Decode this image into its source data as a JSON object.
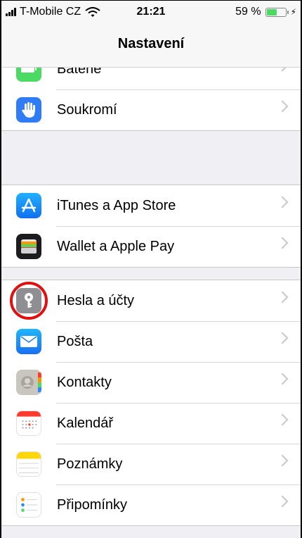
{
  "status_bar": {
    "carrier": "T-Mobile CZ",
    "time": "21:21",
    "battery_percent": "59 %",
    "battery_level": 0.59
  },
  "nav": {
    "title": "Nastavení"
  },
  "groups": [
    {
      "items": [
        {
          "label": "Baterie",
          "icon": "battery-icon",
          "color": "#4cd964"
        },
        {
          "label": "Soukromí",
          "icon": "hand-icon",
          "color": "#2f7cf6"
        }
      ]
    },
    {
      "items": [
        {
          "label": "iTunes a App Store",
          "icon": "app-store-icon",
          "color": "#1a8cff"
        },
        {
          "label": "Wallet a Apple Pay",
          "icon": "wallet-icon",
          "color": "#1c1c1e"
        }
      ]
    },
    {
      "items": [
        {
          "label": "Hesla a účty",
          "icon": "key-icon",
          "color": "#8e8e93",
          "highlighted": true
        },
        {
          "label": "Pošta",
          "icon": "mail-icon",
          "color": "#2f88f5"
        },
        {
          "label": "Kontakty",
          "icon": "contacts-icon",
          "color": "#b5b2ad"
        },
        {
          "label": "Kalendář",
          "icon": "calendar-icon",
          "color": "#ffffff"
        },
        {
          "label": "Poznámky",
          "icon": "notes-icon",
          "color": "#ffffff"
        },
        {
          "label": "Připomínky",
          "icon": "reminders-icon",
          "color": "#ffffff"
        }
      ]
    }
  ]
}
